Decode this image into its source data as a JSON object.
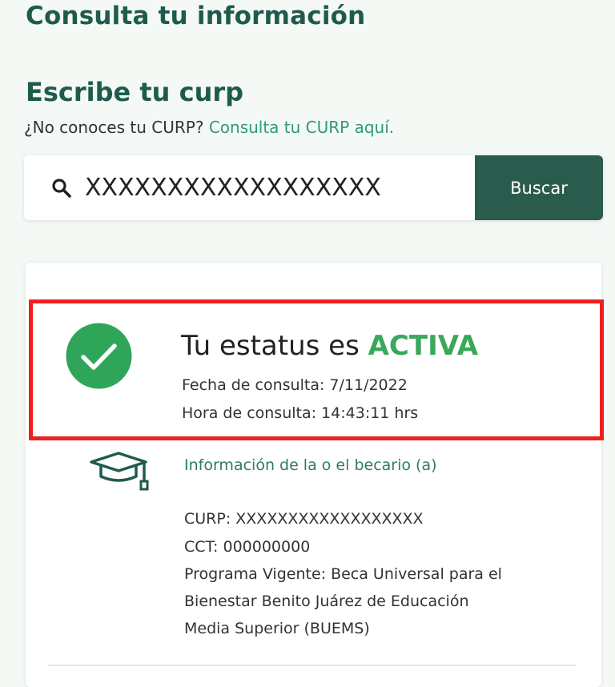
{
  "header": {
    "title": "Consulta tu información"
  },
  "search_section": {
    "title": "Escribe tu curp",
    "help_text": "¿No conoces tu CURP?",
    "help_link": "Consulta tu CURP aquí.",
    "input_value": "XXXXXXXXXXXXXXXXXX",
    "button_label": "Buscar"
  },
  "status": {
    "label": "Tu estatus es",
    "value": "ACTIVA",
    "date_line": "Fecha de consulta: 7/11/2022",
    "time_line": "Hora de consulta: 14:43:11 hrs"
  },
  "becario": {
    "title": "Información de la o el becario (a)",
    "curp_line": "CURP: XXXXXXXXXXXXXXXXXX",
    "cct_line": "CCT: 000000000",
    "program_lines": [
      "Programa Vigente: Beca Universal para el",
      "Bienestar Benito Juárez de Educación",
      "Media Superior (BUEMS)"
    ]
  },
  "icons": {
    "search": "search-icon",
    "status": "check-circle-icon",
    "becario": "mortarboard-icon"
  },
  "colors": {
    "brand_green": "#1f5b4c",
    "button_green": "#2a5c4d",
    "link_green": "#2e9a78",
    "active_green": "#3aa85b",
    "highlight_red": "#ef2020"
  }
}
